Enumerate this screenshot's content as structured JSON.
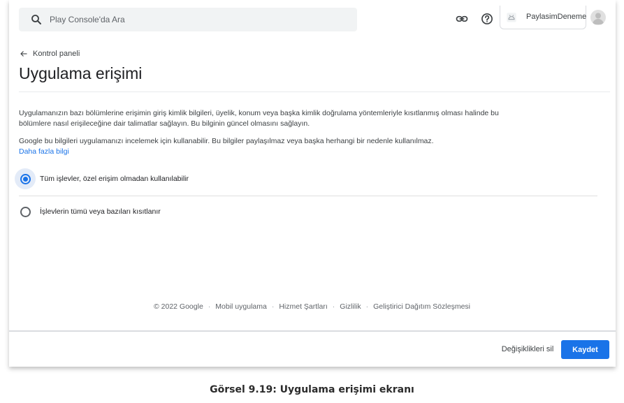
{
  "search": {
    "placeholder": "Play Console'da Ara"
  },
  "header": {
    "link_icon": "link-icon",
    "help_icon": "help-circle-icon",
    "account_name": "PaylasimDeneme",
    "app_icon": "android-app-icon",
    "avatar_icon": "person-avatar-icon"
  },
  "breadcrumb": {
    "label": "Kontrol paneli",
    "icon": "arrow-back-icon"
  },
  "page": {
    "title": "Uygulama erişimi",
    "description_1": "Uygulamanızın bazı bölümlerine erişimin giriş kimlik bilgileri, üyelik, konum veya başka kimlik doğrulama yöntemleriyle kısıtlanmış olması halinde bu bölümlere nasıl erişileceğine dair talimatlar sağlayın. Bu bilginin güncel olmasını sağlayın.",
    "description_2": "Google bu bilgileri uygulamanızı incelemek için kullanabilir. Bu bilgiler paylaşılmaz veya başka herhangi bir nedenle kullanılmaz.",
    "learn_more": "Daha fazla bilgi"
  },
  "options": [
    {
      "label": "Tüm işlevler, özel erişim olmadan kullanılabilir",
      "selected": true
    },
    {
      "label": "İşlevlerin tümü veya bazıları kısıtlanır",
      "selected": false
    }
  ],
  "footer": {
    "copyright": "© 2022 Google",
    "links": [
      "Mobil uygulama",
      "Hizmet Şartları",
      "Gizlilik",
      "Geliştirici Dağıtım Sözleşmesi"
    ]
  },
  "actions": {
    "discard_label": "Değişiklikleri sil",
    "save_label": "Kaydet"
  },
  "caption": "Görsel 9.19: Uygulama erişimi ekranı",
  "colors": {
    "accent": "#1a73e8",
    "search_bg": "#f1f3f4",
    "selected_halo": "#e3ebf8"
  }
}
